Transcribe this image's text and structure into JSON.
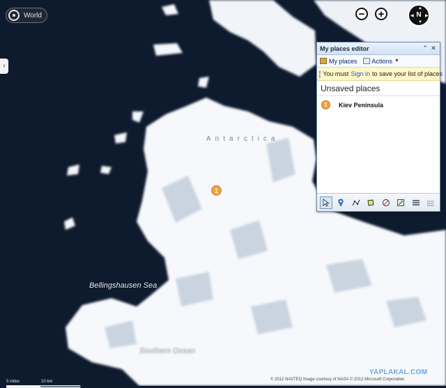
{
  "map": {
    "labels": {
      "sea_1": "Bellingshausen Sea",
      "sea_2": "Southern Ocean",
      "region": "Antarctica"
    },
    "colors": {
      "ocean": "#0e1a2e",
      "ice": "#f6f8fb",
      "shadow": "#a7b8cc"
    }
  },
  "controls": {
    "world_label": "World",
    "zoom_out": "−",
    "zoom_in": "+",
    "compass_label": "N"
  },
  "panel": {
    "title": "My places editor",
    "tabs": [
      {
        "label": "My places"
      },
      {
        "label": "Actions"
      }
    ],
    "notice_prefix": "You must ",
    "notice_link": "Sign in",
    "notice_suffix": " to save your list of places",
    "section_title": "Unsaved places",
    "places": [
      {
        "number": "1",
        "name": "Kiev Peninsula"
      }
    ],
    "tools": [
      "select-icon",
      "pushpin-icon",
      "polyline-icon",
      "polygon-icon",
      "import-icon",
      "edit-icon",
      "list-icon",
      "more-icon"
    ]
  },
  "marker": {
    "number": "1"
  },
  "scale": {
    "label_a": "5 miles",
    "label_b": "10 km"
  },
  "footer": {
    "copyright": "© 2012 NAVTEQ   Image courtesy of NASA   © 2012 Microsoft Corporation",
    "watermark": "YAPLAKAL.COM"
  }
}
